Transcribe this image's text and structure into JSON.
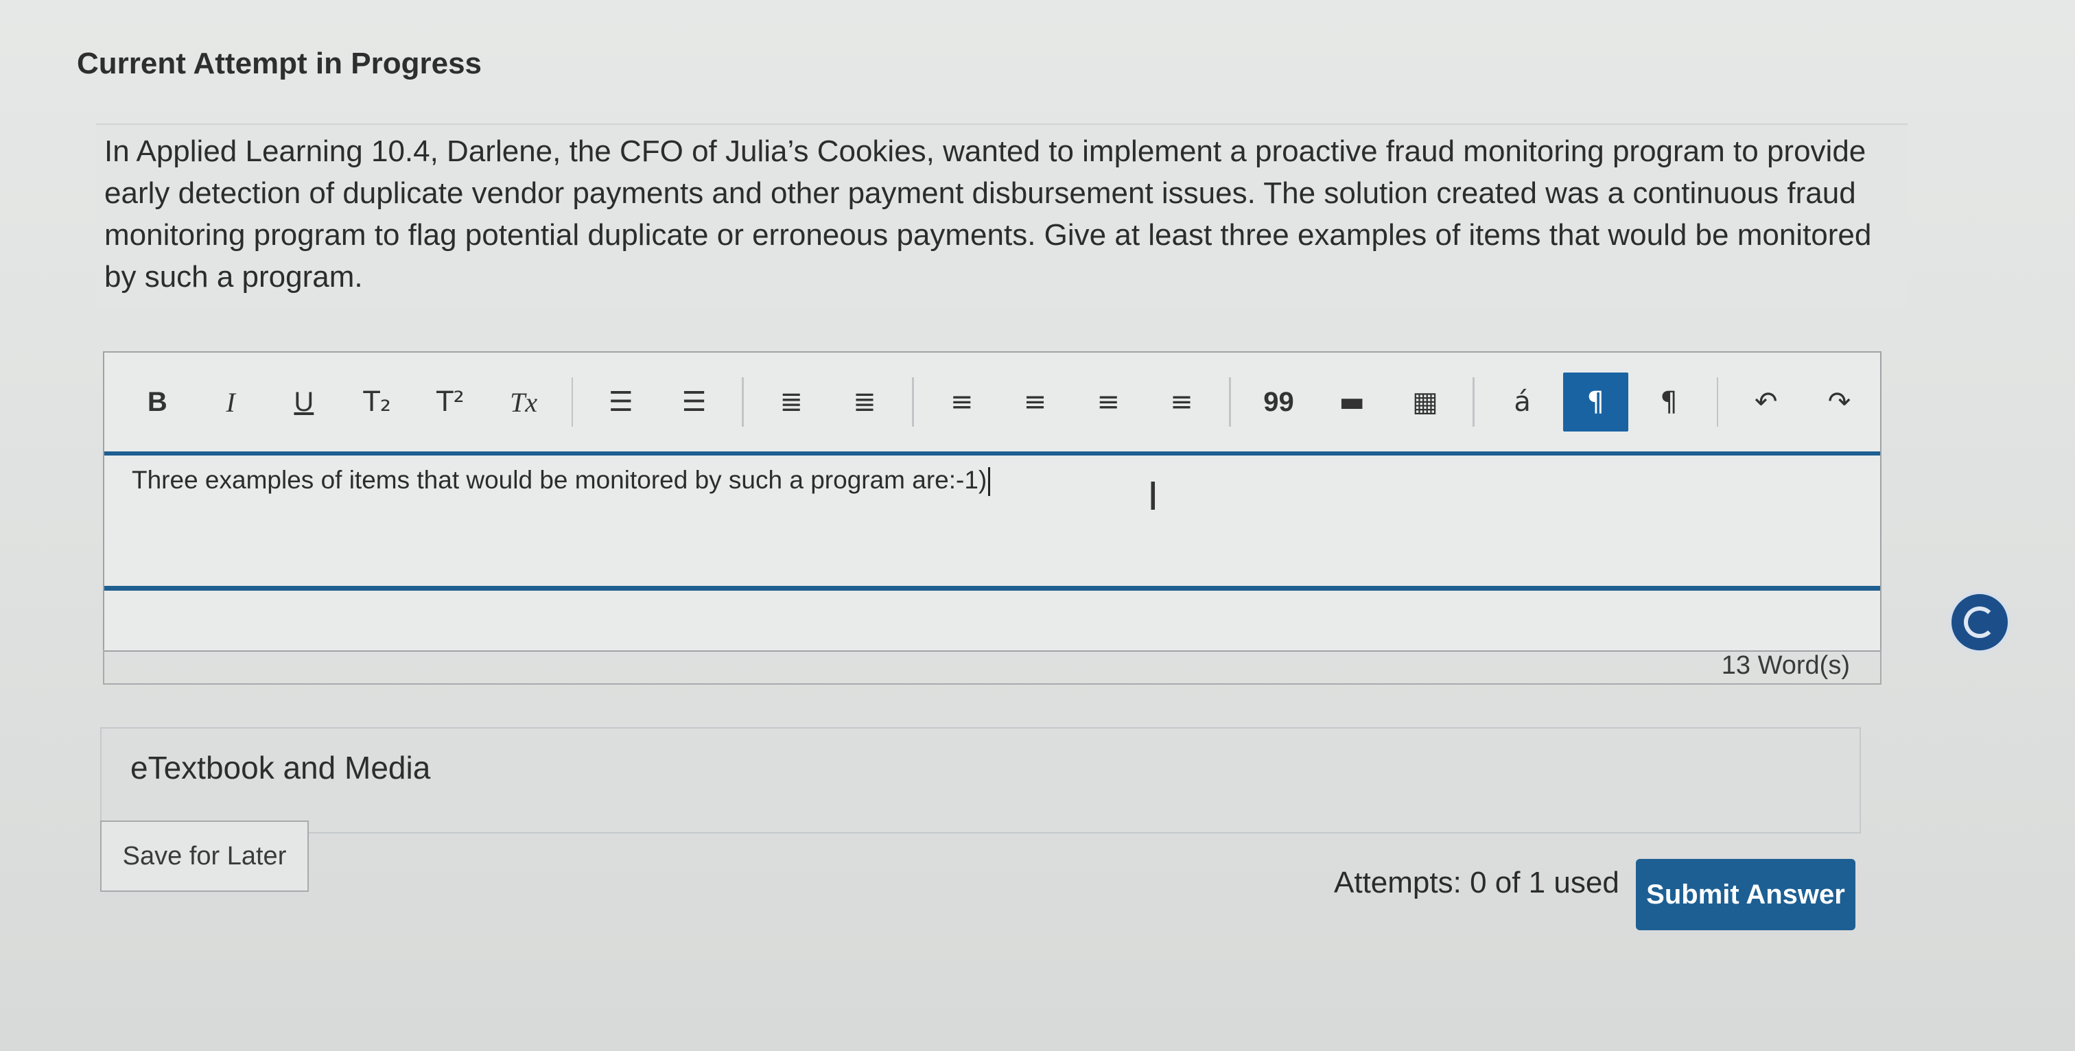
{
  "header": {
    "title": "Current Attempt in Progress"
  },
  "question": {
    "text": "In Applied Learning 10.4, Darlene, the CFO of Julia’s Cookies, wanted to implement a proactive fraud monitoring program to provide early detection of duplicate vendor payments and other payment disbursement issues. The solution created was a continuous fraud monitoring program to flag potential duplicate or erroneous payments. Give at least three examples of items that would be monitored by such a program."
  },
  "toolbar": {
    "bold": "B",
    "italic": "I",
    "underline": "U",
    "subscript": "T₂",
    "superscript": "T²",
    "clear_format": "Tx",
    "bullet_list": "☰",
    "numbered_list": "☰",
    "outdent": "≣",
    "indent": "≣",
    "align_left": "≡",
    "align_center": "≡",
    "align_right": "≡",
    "justify": "≡",
    "quote": "99",
    "horizontal_rule": "▬",
    "table": "▦",
    "special_char": "á",
    "ltr": "¶",
    "rtl": "¶",
    "undo": "↶",
    "redo": "↷"
  },
  "editor": {
    "content": "Three examples of items that would be monitored by such a program are:-1)",
    "word_count": "13 Word(s)"
  },
  "resources": {
    "label": "eTextbook and Media"
  },
  "footer": {
    "save_label": "Save for Later",
    "attempts": "Attempts: 0 of 1 used",
    "submit_label": "Submit Answer"
  },
  "colors": {
    "accent": "#1d5f93",
    "rule": "#1f5f91"
  }
}
